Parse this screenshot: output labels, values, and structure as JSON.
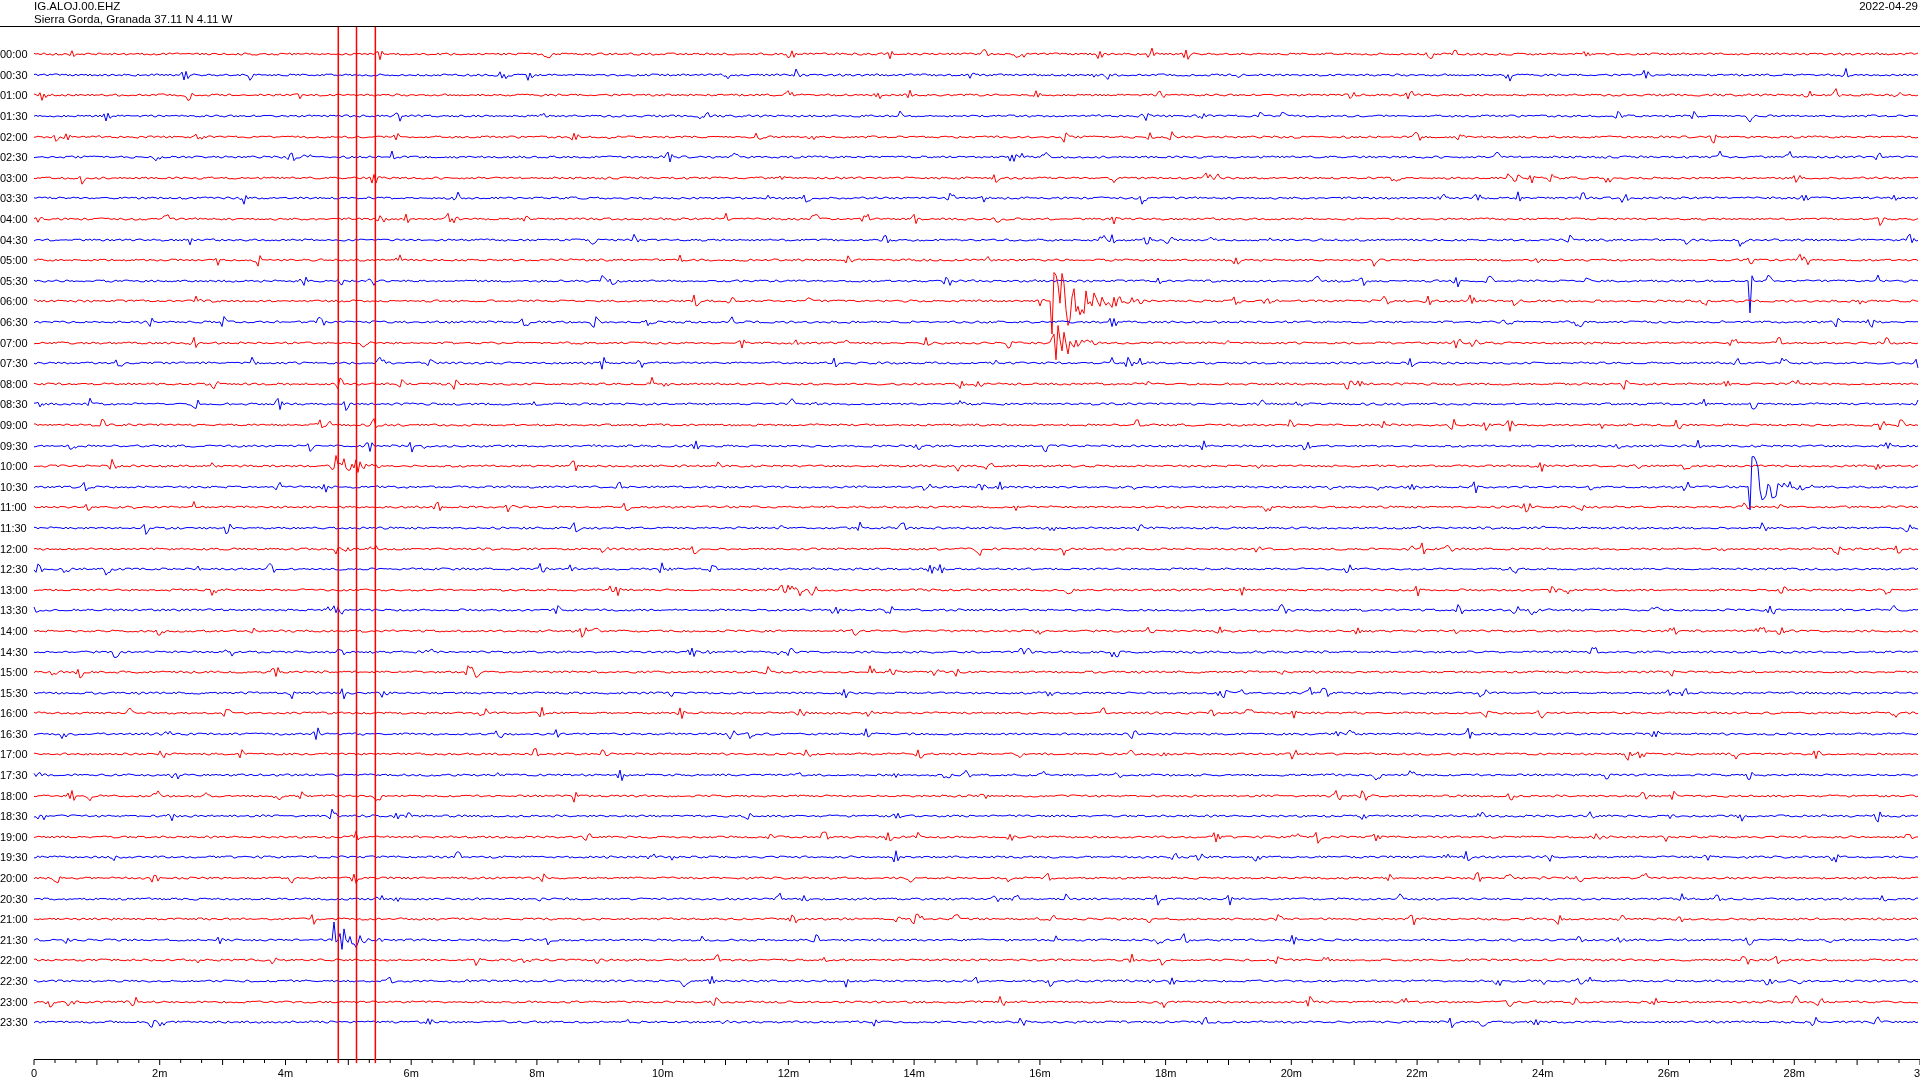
{
  "header": {
    "station": "IG.ALOJ.00.EHZ",
    "location": "Sierra Gorda, Granada  37.11 N 4.11 W",
    "date": "2022-04-29"
  },
  "rows": [
    {
      "time": "00:00",
      "color": "#ff0000"
    },
    {
      "time": "00:30",
      "color": "#0000ff"
    },
    {
      "time": "01:00",
      "color": "#ff0000"
    },
    {
      "time": "01:30",
      "color": "#0000ff"
    },
    {
      "time": "02:00",
      "color": "#ff0000"
    },
    {
      "time": "02:30",
      "color": "#0000ff"
    },
    {
      "time": "03:00",
      "color": "#ff0000"
    },
    {
      "time": "03:30",
      "color": "#0000ff"
    },
    {
      "time": "04:00",
      "color": "#ff0000"
    },
    {
      "time": "04:30",
      "color": "#0000ff"
    },
    {
      "time": "05:00",
      "color": "#ff0000"
    },
    {
      "time": "05:30",
      "color": "#0000ff"
    },
    {
      "time": "06:00",
      "color": "#ff0000"
    },
    {
      "time": "06:30",
      "color": "#0000ff"
    },
    {
      "time": "07:00",
      "color": "#ff0000"
    },
    {
      "time": "07:30",
      "color": "#0000ff"
    },
    {
      "time": "08:00",
      "color": "#ff0000"
    },
    {
      "time": "08:30",
      "color": "#0000ff"
    },
    {
      "time": "09:00",
      "color": "#ff0000"
    },
    {
      "time": "09:30",
      "color": "#0000ff"
    },
    {
      "time": "10:00",
      "color": "#ff0000"
    },
    {
      "time": "10:30",
      "color": "#0000ff"
    },
    {
      "time": "11:00",
      "color": "#ff0000"
    },
    {
      "time": "11:30",
      "color": "#0000ff"
    },
    {
      "time": "12:00",
      "color": "#ff0000"
    },
    {
      "time": "12:30",
      "color": "#0000ff"
    },
    {
      "time": "13:00",
      "color": "#ff0000"
    },
    {
      "time": "13:30",
      "color": "#0000ff"
    },
    {
      "time": "14:00",
      "color": "#ff0000"
    },
    {
      "time": "14:30",
      "color": "#0000ff"
    },
    {
      "time": "15:00",
      "color": "#ff0000"
    },
    {
      "time": "15:30",
      "color": "#0000ff"
    },
    {
      "time": "16:00",
      "color": "#ff0000"
    },
    {
      "time": "16:30",
      "color": "#0000ff"
    },
    {
      "time": "17:00",
      "color": "#ff0000"
    },
    {
      "time": "17:30",
      "color": "#0000ff"
    },
    {
      "time": "18:00",
      "color": "#ff0000"
    },
    {
      "time": "18:30",
      "color": "#0000ff"
    },
    {
      "time": "19:00",
      "color": "#ff0000"
    },
    {
      "time": "19:30",
      "color": "#0000ff"
    },
    {
      "time": "20:00",
      "color": "#ff0000"
    },
    {
      "time": "20:30",
      "color": "#0000ff"
    },
    {
      "time": "21:00",
      "color": "#ff0000"
    },
    {
      "time": "21:30",
      "color": "#0000ff"
    },
    {
      "time": "22:00",
      "color": "#ff0000"
    },
    {
      "time": "22:30",
      "color": "#0000ff"
    },
    {
      "time": "23:00",
      "color": "#ff0000"
    },
    {
      "time": "23:30",
      "color": "#0000ff"
    }
  ],
  "x_axis": {
    "tick_labels": [
      "0",
      "2m",
      "4m",
      "6m",
      "8m",
      "10m",
      "12m",
      "14m",
      "16m",
      "18m",
      "20m",
      "22m",
      "24m",
      "26m",
      "28m",
      "3"
    ]
  }
}
